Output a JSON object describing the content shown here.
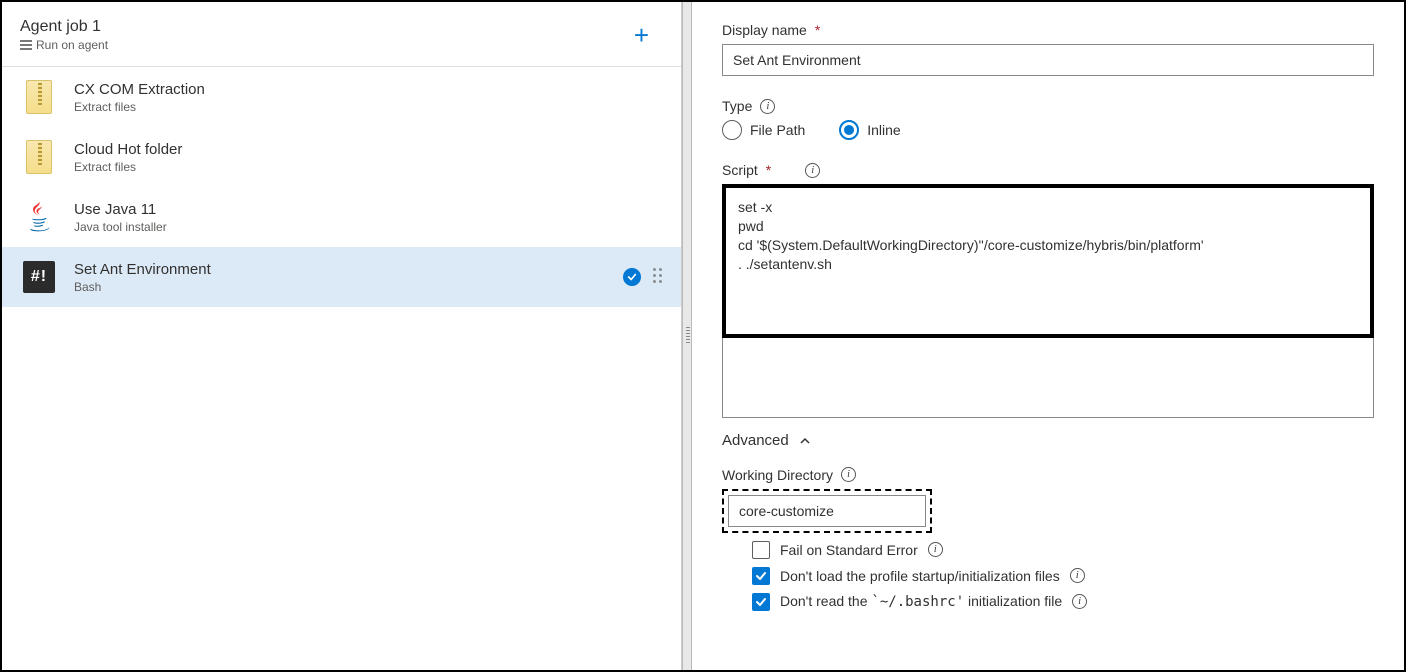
{
  "job": {
    "title": "Agent job 1",
    "subtitle": "Run on agent"
  },
  "tasks": [
    {
      "title": "CX COM Extraction",
      "subtitle": "Extract files",
      "icon": "zip",
      "selected": false
    },
    {
      "title": "Cloud Hot folder",
      "subtitle": "Extract files",
      "icon": "zip",
      "selected": false
    },
    {
      "title": "Use Java 11",
      "subtitle": "Java tool installer",
      "icon": "java",
      "selected": false
    },
    {
      "title": "Set Ant Environment",
      "subtitle": "Bash",
      "icon": "bash",
      "selected": true
    }
  ],
  "form": {
    "display_name_label": "Display name",
    "display_name_value": "Set Ant Environment",
    "type_label": "Type",
    "type_options": {
      "file_path": "File Path",
      "inline": "Inline"
    },
    "type_selected": "inline",
    "script_label": "Script",
    "script_value": "set -x\npwd\ncd '$(System.DefaultWorkingDirectory)''/core-customize/hybris/bin/platform'\n. ./setantenv.sh",
    "advanced_label": "Advanced",
    "working_dir_label": "Working Directory",
    "working_dir_value": "core-customize",
    "fail_on_err_label": "Fail on Standard Error",
    "fail_on_err_checked": false,
    "noprofile_label_pre": "Don't load the profile startup/initialization files",
    "noprofile_checked": true,
    "norc_label_pre": "Don't read the ",
    "norc_label_code": "`~/.bashrc'",
    "norc_label_post": " initialization file",
    "norc_checked": true
  }
}
